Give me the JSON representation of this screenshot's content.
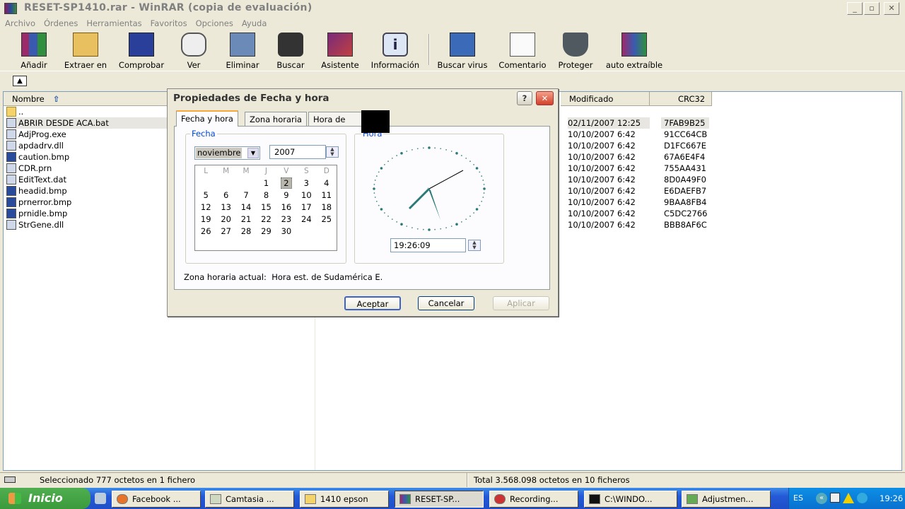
{
  "window": {
    "title": "RESET-SP1410.rar - WinRAR (copia de evaluación)"
  },
  "menu": [
    "Archivo",
    "Órdenes",
    "Herramientas",
    "Favoritos",
    "Opciones",
    "Ayuda"
  ],
  "toolbar": [
    {
      "label": "Añadir",
      "icon": "books-add-icon"
    },
    {
      "label": "Extraer en",
      "icon": "extract-folder-icon"
    },
    {
      "label": "Comprobar",
      "icon": "test-book-icon"
    },
    {
      "label": "Ver",
      "icon": "view-glasses-icon"
    },
    {
      "label": "Eliminar",
      "icon": "delete-bin-icon"
    },
    {
      "label": "Buscar",
      "icon": "binoculars-icon"
    },
    {
      "label": "Asistente",
      "icon": "wizard-icon"
    },
    {
      "label": "Información",
      "icon": "info-icon"
    },
    {
      "label": "Buscar virus",
      "icon": "virus-scan-icon"
    },
    {
      "label": "Comentario",
      "icon": "comment-icon"
    },
    {
      "label": "Proteger",
      "icon": "shield-icon"
    },
    {
      "label": "auto extraíble",
      "icon": "sfx-icon"
    }
  ],
  "columns": {
    "name": "Nombre",
    "modified": "Modificado",
    "crc": "CRC32"
  },
  "files": [
    {
      "name": "..",
      "icon": "folder-up-icon",
      "modified": "",
      "crc": ""
    },
    {
      "name": "ABRIR DESDE ACA.bat",
      "icon": "bat-file-icon",
      "modified": "02/11/2007 12:25",
      "crc": "7FAB9B25"
    },
    {
      "name": "AdjProg.exe",
      "icon": "exe-file-icon",
      "modified": "10/10/2007 6:42",
      "crc": "91CC64CB"
    },
    {
      "name": "apdadrv.dll",
      "icon": "dll-file-icon",
      "modified": "10/10/2007 6:42",
      "crc": "D1FC667E"
    },
    {
      "name": "caution.bmp",
      "icon": "bmp-file-icon",
      "modified": "10/10/2007 6:42",
      "crc": "67A6E4F4"
    },
    {
      "name": "CDR.prn",
      "icon": "prn-file-icon",
      "modified": "10/10/2007 6:42",
      "crc": "755AA431"
    },
    {
      "name": "EditText.dat",
      "icon": "dat-file-icon",
      "modified": "10/10/2007 6:42",
      "crc": "8D0A49F0"
    },
    {
      "name": "headid.bmp",
      "icon": "bmp-file-icon",
      "modified": "10/10/2007 6:42",
      "crc": "E6DAEFB7"
    },
    {
      "name": "prnerror.bmp",
      "icon": "bmp-file-icon",
      "modified": "10/10/2007 6:42",
      "crc": "9BAA8FB4"
    },
    {
      "name": "prnidle.bmp",
      "icon": "bmp-file-icon",
      "modified": "10/10/2007 6:42",
      "crc": "C5DC2766"
    },
    {
      "name": "StrGene.dll",
      "icon": "dll-file-icon",
      "modified": "10/10/2007 6:42",
      "crc": "BBB8AF6C"
    }
  ],
  "status": {
    "left": "Seleccionado 777 octetos en 1 fichero",
    "right": "Total 3.568.098 octetos en 10 ficheros"
  },
  "dialog": {
    "title": "Propiedades de Fecha y hora",
    "tabs": [
      "Fecha y hora",
      "Zona horaria",
      "Hora de Int"
    ],
    "date_group": "Fecha",
    "month": "noviembre",
    "year": "2007",
    "weekdays": [
      "L",
      "M",
      "M",
      "J",
      "V",
      "S",
      "D"
    ],
    "calendar": [
      [
        "",
        "",
        "",
        "1",
        "2",
        "3",
        "4"
      ],
      [
        "5",
        "6",
        "7",
        "8",
        "9",
        "10",
        "11"
      ],
      [
        "12",
        "13",
        "14",
        "15",
        "16",
        "17",
        "18"
      ],
      [
        "19",
        "20",
        "21",
        "22",
        "23",
        "24",
        "25"
      ],
      [
        "26",
        "27",
        "28",
        "29",
        "30",
        "",
        ""
      ]
    ],
    "selected_day": "2",
    "time_group": "Hora",
    "time": "19:26:09",
    "zone_text": "Zona horaria actual:  Hora est. de Sudamérica E.",
    "buttons": {
      "ok": "Aceptar",
      "cancel": "Cancelar",
      "apply": "Aplicar"
    },
    "help": "?",
    "close": "✕"
  },
  "taskbar": {
    "start": "Inicio",
    "tasks": [
      "Facebook ...",
      "Camtasia ...",
      "1410 epson",
      "RESET-SP...",
      "Recording...",
      "C:\\WINDO...",
      "Adjustmen..."
    ],
    "lang": "ES",
    "clock": "19:26"
  }
}
